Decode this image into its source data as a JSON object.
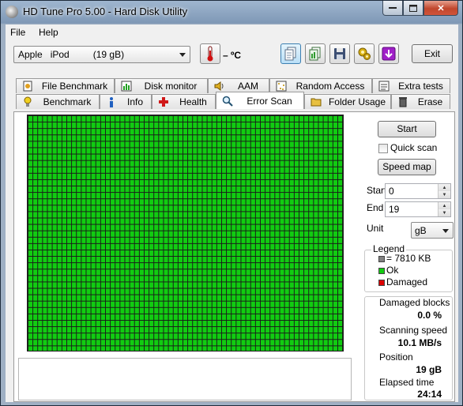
{
  "window": {
    "title": "HD Tune Pro 5.00 - Hard Disk Utility",
    "close_symbol": "✕"
  },
  "menu": {
    "file": "File",
    "help": "Help"
  },
  "toolbar": {
    "drive": "Apple   iPod         (19 gB)",
    "temperature": "– ºC",
    "exit_label": "Exit",
    "icons": [
      "thermometer-icon",
      "copy-text-icon",
      "copy-screenshot-icon",
      "save-icon",
      "options-icon",
      "update-icon"
    ]
  },
  "tabs": {
    "row1": [
      "File Benchmark",
      "Disk monitor",
      "AAM",
      "Random Access",
      "Extra tests"
    ],
    "row2": [
      "Benchmark",
      "Info",
      "Health",
      "Error Scan",
      "Folder Usage",
      "Erase"
    ],
    "active": "Error Scan"
  },
  "scan": {
    "start_button": "Start",
    "quick_scan_label": "Quick scan",
    "quick_scan_checked": false,
    "speed_map_button": "Speed map",
    "start_label": "Start",
    "start_value": "0",
    "end_label": "End",
    "end_value": "19",
    "unit_label": "Unit",
    "unit_value": "gB",
    "block_state": "ok"
  },
  "legend": {
    "title": "Legend",
    "block_size": "= 7810 KB",
    "ok": "Ok",
    "damaged": "Damaged",
    "colors": {
      "block": "#808080",
      "ok": "#11cc11",
      "damaged": "#dd0000"
    }
  },
  "stats": {
    "damaged_blocks_label": "Damaged blocks",
    "damaged_blocks_value": "0.0 %",
    "scanning_speed_label": "Scanning speed",
    "scanning_speed_value": "10.1 MB/s",
    "position_label": "Position",
    "position_value": "19 gB",
    "elapsed_label": "Elapsed time",
    "elapsed_value": "24:14"
  }
}
